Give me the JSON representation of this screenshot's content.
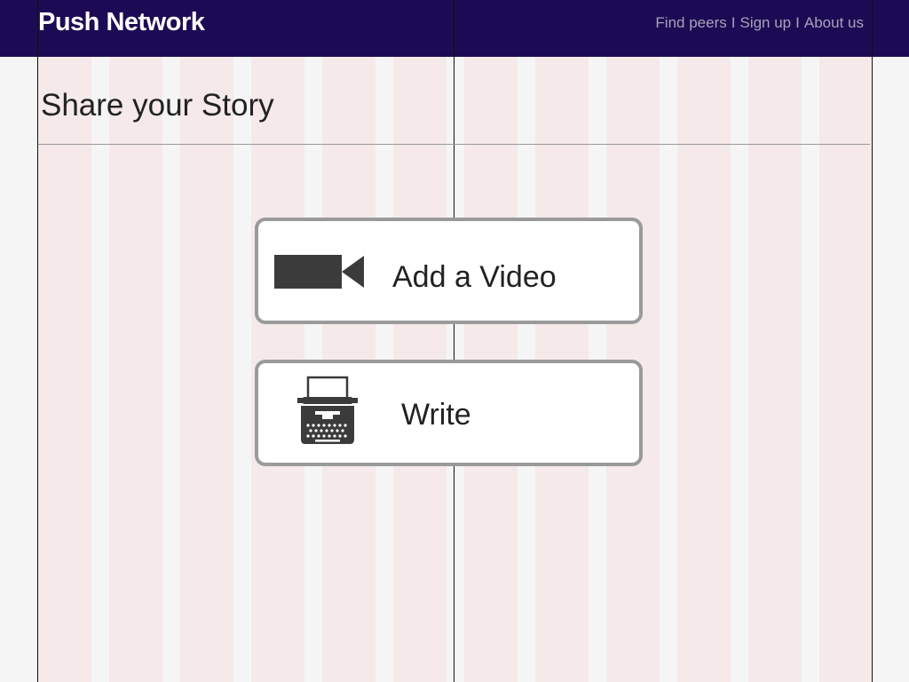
{
  "header": {
    "brand": "Push Network",
    "nav": [
      {
        "label": "Find peers"
      },
      {
        "label": "Sign up"
      },
      {
        "label": "About us"
      }
    ],
    "separator": "I"
  },
  "main": {
    "title": "Share your Story",
    "actions": [
      {
        "label": "Add a Video",
        "icon": "video-camera-icon"
      },
      {
        "label": "Write",
        "icon": "typewriter-icon"
      }
    ]
  },
  "colors": {
    "header_bg": "#1c0b54",
    "nav_text": "#a7a2b8",
    "grid_column": "#f5e9e9",
    "button_border": "#9a9a9a"
  }
}
